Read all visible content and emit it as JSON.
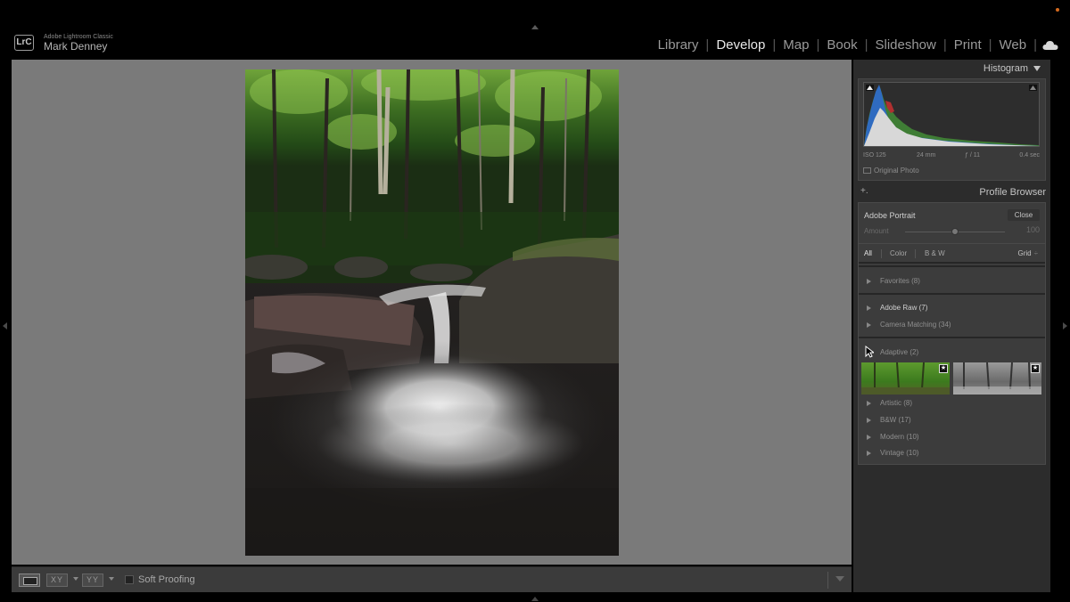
{
  "app": {
    "logo": "LrC",
    "product": "Adobe Lightroom Classic",
    "user": "Mark Denney"
  },
  "modules": [
    {
      "label": "Library",
      "active": false
    },
    {
      "label": "Develop",
      "active": true
    },
    {
      "label": "Map",
      "active": false
    },
    {
      "label": "Book",
      "active": false
    },
    {
      "label": "Slideshow",
      "active": false
    },
    {
      "label": "Print",
      "active": false
    },
    {
      "label": "Web",
      "active": false
    }
  ],
  "toolbar": {
    "soft_proofing": "Soft Proofing",
    "compare_icon": "XY",
    "survey_icon": "YY"
  },
  "histogram": {
    "title": "Histogram",
    "iso": "ISO 125",
    "focal": "24 mm",
    "aperture": "ƒ / 11",
    "shutter": "0.4 sec",
    "original_photo": "Original Photo"
  },
  "profile_browser": {
    "title": "Profile Browser",
    "plus": "+.",
    "profile_name": "Adobe Portrait",
    "close_label": "Close",
    "amount_label": "Amount",
    "amount_value": "100",
    "amount_fraction": 0.5,
    "filters": {
      "all": "All",
      "color": "Color",
      "bw": "B & W",
      "grid": "Grid",
      "grid_caret": "÷"
    },
    "groups": {
      "favorites": "Favorites (8)",
      "adobe_raw": "Adobe Raw (7)",
      "camera_matching": "Camera Matching (34)",
      "adaptive": "Adaptive (2)",
      "artistic": "Artistic (8)",
      "bw": "B&W (17)",
      "modern": "Modern (10)",
      "vintage": "Vintage (10)"
    }
  },
  "colors": {
    "canvas_bg": "#7a7a7a",
    "panel_bg": "#2c2c2c",
    "active_module": "#e8e8e8"
  }
}
